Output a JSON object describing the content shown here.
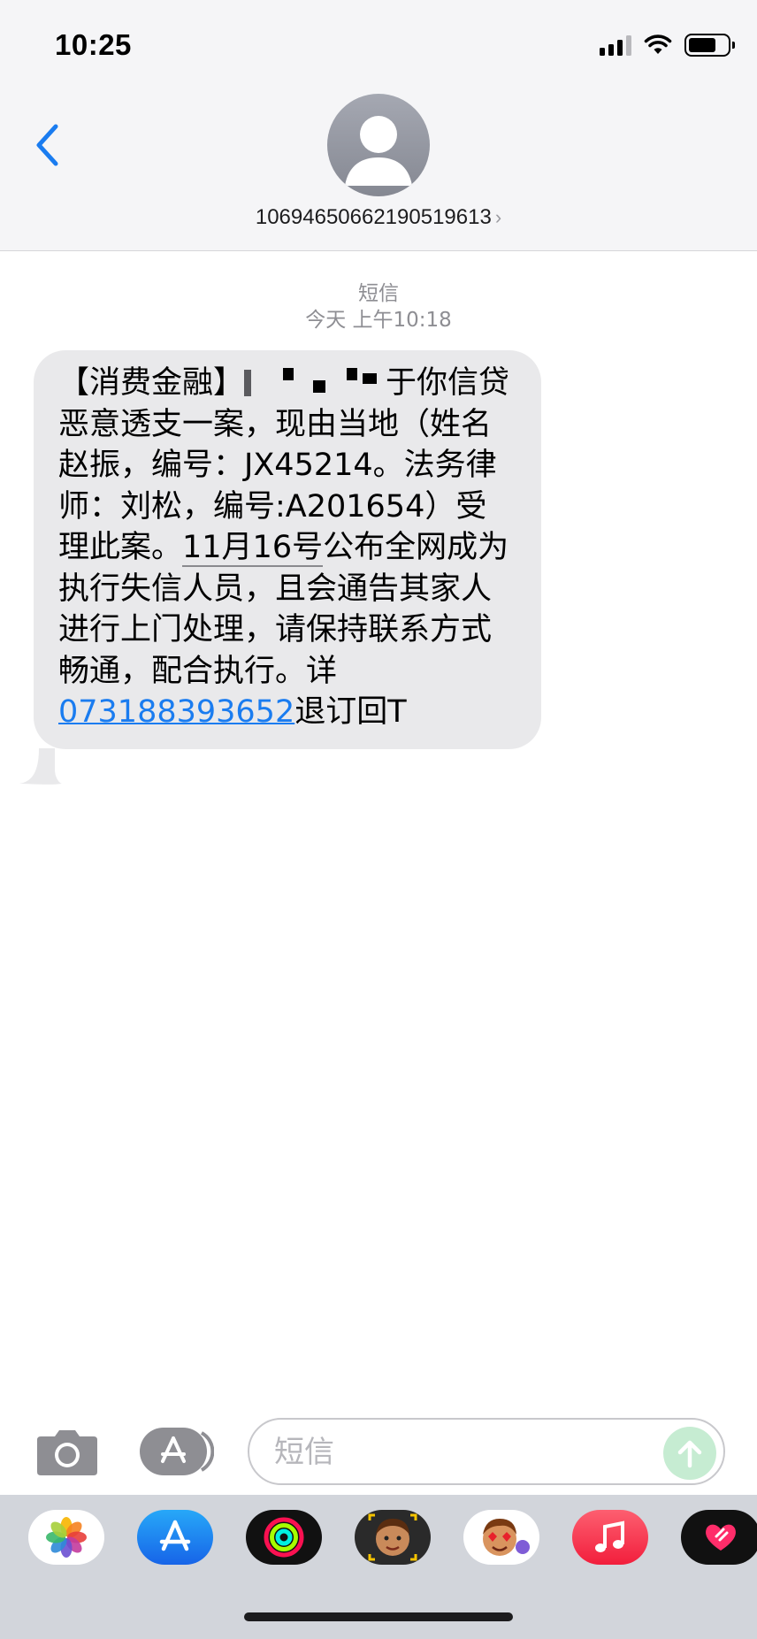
{
  "status_bar": {
    "time": "10:25",
    "icons": [
      "cellular-signal-icon",
      "wifi-icon",
      "battery-icon"
    ]
  },
  "header": {
    "back_icon": "chevron-left-icon",
    "avatar_icon": "person-silhouette-icon",
    "contact_number": "10694650662190519613",
    "contact_chevron": "›"
  },
  "conversation": {
    "message_type": "短信",
    "timestamp": "今天 上午10:18",
    "message": {
      "prefix": "【消费金融】",
      "text_1": "于你信贷恶意透支一案，现由当地（姓名赵振，编号：JX45214。法务律师：刘松，编号:A201654）受理此案。",
      "date_link": "11月16号",
      "text_2": "公布全网成为执行失信人员，且会通告其家人进行上门处理，请保持联系方式畅通，配合执行。详",
      "phone_link": "073188393652",
      "suffix": "退订回T"
    }
  },
  "input_bar": {
    "camera_icon": "camera-icon",
    "apps_icon": "app-store-icon",
    "placeholder": "短信",
    "send_icon": "arrow-up-icon"
  },
  "app_drawer": {
    "apps": [
      "photos-app-icon",
      "app-store-app-icon",
      "activity-app-icon",
      "memoji-app-icon",
      "animoji-app-icon",
      "music-app-icon",
      "digital-touch-app-icon"
    ]
  },
  "colors": {
    "accent": "#1a7cf0",
    "bubble": "#e9e9eb",
    "header_bg": "#f5f5f7",
    "drawer_bg": "#d2d5db"
  }
}
